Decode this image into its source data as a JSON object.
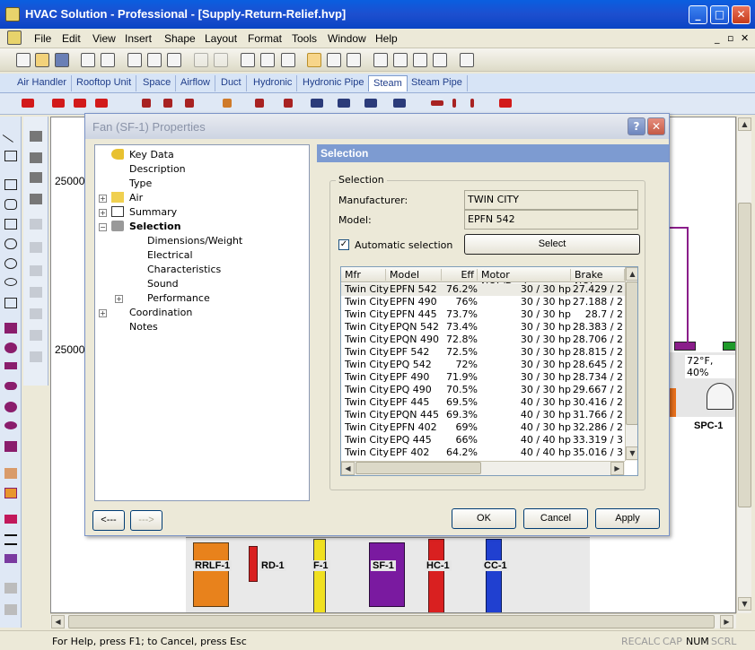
{
  "window": {
    "title": "HVAC Solution - Professional - [Supply-Return-Relief.hvp]",
    "minimize_glyph": "_",
    "maximize_glyph": "□",
    "close_glyph": "✕"
  },
  "menu": [
    "File",
    "Edit",
    "View",
    "Insert",
    "Shape",
    "Layout",
    "Format",
    "Tools",
    "Window",
    "Help"
  ],
  "mdi_controls": [
    "_",
    "▫",
    "✕"
  ],
  "library_tabs": [
    "Air Handler",
    "Rooftop Unit",
    "Space",
    "Airflow",
    "Duct",
    "Hydronic",
    "Hydronic Pipe",
    "Steam",
    "Steam Pipe"
  ],
  "active_tab": "Steam",
  "canvas": {
    "ruler_labels": [
      "25000",
      "25000"
    ],
    "equipment": [
      "RRLF-1",
      "RD-1",
      "F-1",
      "SF-1",
      "HC-1",
      "CC-1",
      "SPC-1"
    ],
    "space_temp": "72°F, 40%"
  },
  "status": {
    "text": "For Help, press F1; to Cancel, press Esc",
    "indicators": [
      "RECALC",
      "CAP",
      "NUM",
      "SCRL"
    ]
  },
  "dialog": {
    "title": "Fan (SF-1) Properties",
    "help_glyph": "?",
    "close_glyph": "✕",
    "tree": [
      {
        "label": "Key Data"
      },
      {
        "label": "Description"
      },
      {
        "label": "Type"
      },
      {
        "label": "Air"
      },
      {
        "label": "Summary"
      },
      {
        "label": "Selection"
      },
      {
        "label": "Dimensions/Weight"
      },
      {
        "label": "Electrical"
      },
      {
        "label": "Characteristics"
      },
      {
        "label": "Sound"
      },
      {
        "label": "Performance"
      },
      {
        "label": "Coordination"
      },
      {
        "label": "Notes"
      }
    ],
    "panel_header": "Selection",
    "group_title": "Selection",
    "manufacturer_label": "Manufacturer:",
    "manufacturer_value": "TWIN CITY",
    "model_label": "Model:",
    "model_value": "EPFN 542",
    "auto_select_label": "Automatic selection",
    "auto_select_checked": true,
    "select_button": "Select",
    "columns": [
      "Mfr",
      "Model",
      "Eff",
      "Motor NOL/Design",
      "Brake NOL"
    ],
    "rows": [
      [
        "Twin City",
        "EPFN 542",
        "76.2%",
        "30 / 30 hp",
        "27.429 / 2"
      ],
      [
        "Twin City",
        "EPFN 490",
        "76%",
        "30 / 30 hp",
        "27.188 / 2"
      ],
      [
        "Twin City",
        "EPFN 445",
        "73.7%",
        "30 / 30 hp",
        "28.7 / 2"
      ],
      [
        "Twin City",
        "EPQN 542",
        "73.4%",
        "30 / 30 hp",
        "28.383 / 2"
      ],
      [
        "Twin City",
        "EPQN 490",
        "72.8%",
        "30 / 30 hp",
        "28.706 / 2"
      ],
      [
        "Twin City",
        "EPF 542",
        "72.5%",
        "30 / 30 hp",
        "28.815 / 2"
      ],
      [
        "Twin City",
        "EPQ 542",
        "72%",
        "30 / 30 hp",
        "28.645 / 2"
      ],
      [
        "Twin City",
        "EPF 490",
        "71.9%",
        "30 / 30 hp",
        "28.734 / 2"
      ],
      [
        "Twin City",
        "EPQ 490",
        "70.5%",
        "30 / 30 hp",
        "29.667 / 2"
      ],
      [
        "Twin City",
        "EPF 445",
        "69.5%",
        "40 / 30 hp",
        "30.416 / 2"
      ],
      [
        "Twin City",
        "EPQN 445",
        "69.3%",
        "40 / 30 hp",
        "31.766 / 2"
      ],
      [
        "Twin City",
        "EPFN 402",
        "69%",
        "40 / 30 hp",
        "32.286 / 2"
      ],
      [
        "Twin City",
        "EPQ 445",
        "66%",
        "40 / 40 hp",
        "33.319 / 3"
      ],
      [
        "Twin City",
        "EPF 402",
        "64.2%",
        "40 / 40 hp",
        "35.016 / 3"
      ]
    ],
    "buttons": {
      "back": "<---",
      "forward": "--->",
      "ok": "OK",
      "cancel": "Cancel",
      "apply": "Apply"
    }
  },
  "colors": {
    "title_blue": "#0a5fe0",
    "panel_header": "#7d9bd1",
    "selection_row": "#ecebe4"
  }
}
